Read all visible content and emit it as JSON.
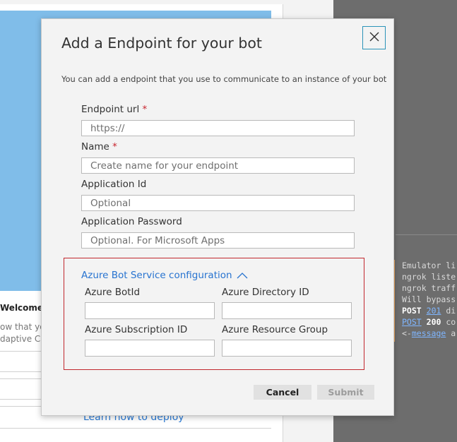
{
  "background": {
    "welcome_text": "Welcome to",
    "line1": "ow that yo",
    "line2": "daptive Ca",
    "learn_link": "Learn how to deploy",
    "log": {
      "lines": [
        {
          "text": "Emulator li"
        },
        {
          "text": "ngrok liste"
        },
        {
          "text": "ngrok traff"
        },
        {
          "text": "Will bypass"
        }
      ],
      "post1": {
        "method": "POST",
        "status": "201",
        "rest": "di"
      },
      "post2": {
        "method": "POST",
        "status": "200",
        "rest": "co"
      },
      "message": {
        "prefix": "<-",
        "link": "message",
        "rest": "a"
      }
    }
  },
  "dialog": {
    "title": "Add a Endpoint for your bot",
    "description": "You can add a endpoint that you use to communicate to an instance of your bot",
    "close_icon": "close-icon",
    "fields": {
      "endpoint_url": {
        "label": "Endpoint url",
        "required_mark": "*",
        "placeholder": "https://",
        "value": ""
      },
      "name": {
        "label": "Name",
        "required_mark": "*",
        "placeholder": "Create name for your endpoint",
        "value": ""
      },
      "app_id": {
        "label": "Application Id",
        "placeholder": "Optional",
        "value": ""
      },
      "app_password": {
        "label": "Application Password",
        "placeholder": "Optional. For Microsoft Apps",
        "value": ""
      }
    },
    "azure": {
      "toggle_label": "Azure Bot Service configuration",
      "toggle_icon": "chevron-up-icon",
      "bot_id_label": "Azure BotId",
      "directory_id_label": "Azure Directory ID",
      "subscription_id_label": "Azure Subscription ID",
      "resource_group_label": "Azure Resource Group"
    },
    "buttons": {
      "cancel": "Cancel",
      "submit": "Submit"
    }
  },
  "colors": {
    "accent_link": "#2773d0",
    "required": "#c8262f",
    "azure_border": "#c1272d",
    "close_border": "#2a93b8"
  }
}
